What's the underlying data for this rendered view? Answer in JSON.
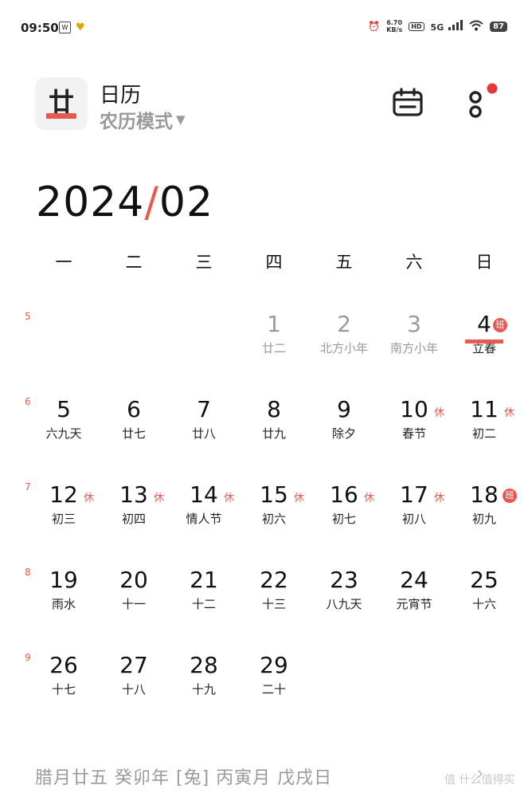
{
  "status": {
    "time": "09:50",
    "speed": "6.70",
    "speed_unit": "KB/s",
    "hd": "HD",
    "network": "5G",
    "battery": "87"
  },
  "header": {
    "app_glyph": "廿",
    "title": "日历",
    "mode": "农历模式"
  },
  "month": {
    "year": "2024",
    "sep": "/",
    "month": "02"
  },
  "weekdays": [
    "一",
    "二",
    "三",
    "四",
    "五",
    "六",
    "日"
  ],
  "weeks": [
    {
      "num": "5",
      "days": [
        null,
        null,
        null,
        {
          "d": "1",
          "l": "廿二",
          "dim": true
        },
        {
          "d": "2",
          "l": "北方小年",
          "dim": true
        },
        {
          "d": "3",
          "l": "南方小年",
          "dim": true
        },
        {
          "d": "4",
          "l": "立春",
          "badge": "班",
          "today": true
        }
      ]
    },
    {
      "num": "6",
      "days": [
        {
          "d": "5",
          "l": "六九天"
        },
        {
          "d": "6",
          "l": "廿七"
        },
        {
          "d": "7",
          "l": "廿八"
        },
        {
          "d": "8",
          "l": "廿九"
        },
        {
          "d": "9",
          "l": "除夕"
        },
        {
          "d": "10",
          "l": "春节",
          "rest": "休"
        },
        {
          "d": "11",
          "l": "初二",
          "rest": "休"
        }
      ]
    },
    {
      "num": "7",
      "days": [
        {
          "d": "12",
          "l": "初三",
          "rest": "休"
        },
        {
          "d": "13",
          "l": "初四",
          "rest": "休"
        },
        {
          "d": "14",
          "l": "情人节",
          "rest": "休"
        },
        {
          "d": "15",
          "l": "初六",
          "rest": "休"
        },
        {
          "d": "16",
          "l": "初七",
          "rest": "休"
        },
        {
          "d": "17",
          "l": "初八",
          "rest": "休"
        },
        {
          "d": "18",
          "l": "初九",
          "badge": "班"
        }
      ]
    },
    {
      "num": "8",
      "days": [
        {
          "d": "19",
          "l": "雨水"
        },
        {
          "d": "20",
          "l": "十一"
        },
        {
          "d": "21",
          "l": "十二"
        },
        {
          "d": "22",
          "l": "十三"
        },
        {
          "d": "23",
          "l": "八九天"
        },
        {
          "d": "24",
          "l": "元宵节"
        },
        {
          "d": "25",
          "l": "十六"
        }
      ]
    },
    {
      "num": "9",
      "days": [
        {
          "d": "26",
          "l": "十七"
        },
        {
          "d": "27",
          "l": "十八"
        },
        {
          "d": "28",
          "l": "十九"
        },
        {
          "d": "29",
          "l": "二十"
        },
        null,
        null,
        null
      ]
    }
  ],
  "footer": {
    "text": "腊月廿五  癸卯年 [兔] 丙寅月 戊戌日",
    "arrow": "›"
  },
  "watermark": "值 什么值得买",
  "colors": {
    "accent": "#e85a4f",
    "muted": "#9a9a9a"
  }
}
